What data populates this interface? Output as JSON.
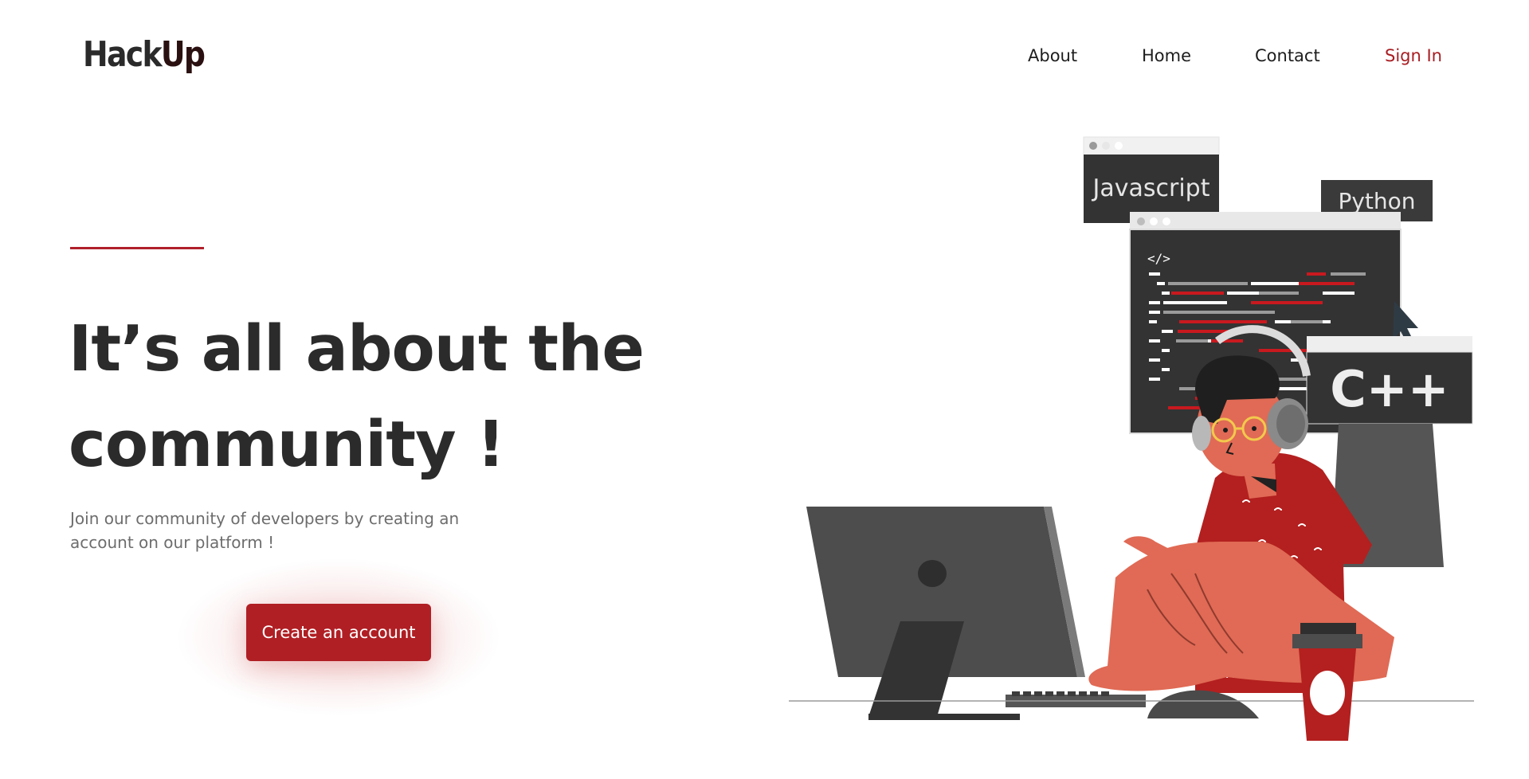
{
  "header": {
    "logo_text_left": "Hack",
    "logo_text_right": "Up",
    "nav": {
      "about": "About",
      "home": "Home",
      "contact": "Contact",
      "sign_in": "Sign In"
    }
  },
  "hero": {
    "title_line1": "It’s all about the",
    "title_line2": "community !",
    "subtitle": "Join our community of developers by creating an account on our platform !",
    "cta_label": "Create an account"
  },
  "illustration": {
    "label_javascript": "Javascript",
    "label_python": "Python",
    "label_cpp": "C++",
    "code_tag": "</>"
  },
  "colors": {
    "accent": "#b01f24",
    "text_dark": "#2b2b2b",
    "text_muted": "#6d6d6d",
    "shirt": "#b3201f",
    "skin": "#e06a55",
    "monitor": "#4d4d4d"
  }
}
